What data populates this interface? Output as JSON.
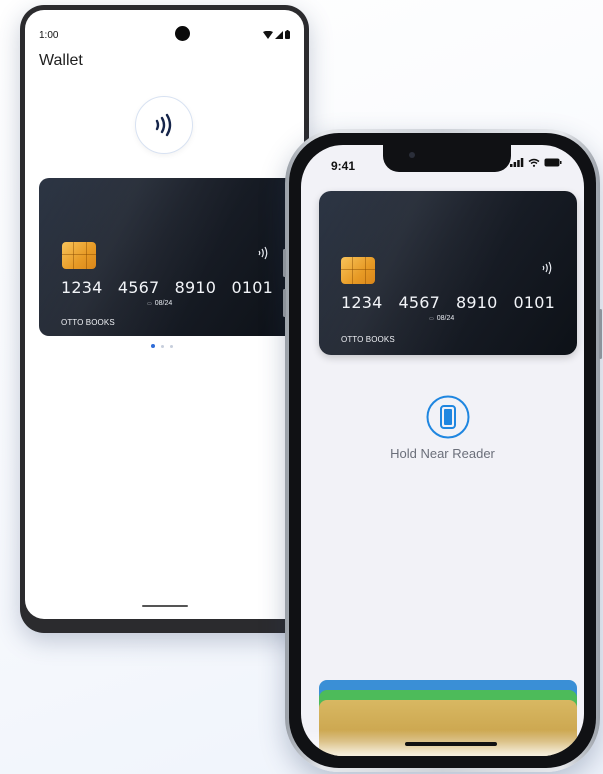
{
  "android": {
    "status_time": "1:00",
    "title": "Wallet",
    "card": {
      "number_groups": [
        "1234",
        "4567",
        "8910",
        "0101"
      ],
      "valid_thru": "08/24",
      "holder": "OTTO BOOKS"
    },
    "pager": {
      "count": 3,
      "active": 0
    }
  },
  "iphone": {
    "status_time": "9:41",
    "card": {
      "number_groups": [
        "1234",
        "4567",
        "8910",
        "0101"
      ],
      "valid_thru": "08/24",
      "holder": "OTTO BOOKS"
    },
    "hold_label": "Hold Near Reader",
    "card_stack_colors": [
      "#3a8fd6",
      "#4dbb5a",
      "#d4b45e"
    ]
  },
  "colors": {
    "accent": "#2f6cd8",
    "card_dark": "#1a1f29",
    "chip": "#f2b04a"
  },
  "icons": [
    "nfc-icon",
    "contactless-icon",
    "signal-icon",
    "wifi-icon",
    "battery-icon",
    "phone-reader-icon"
  ]
}
